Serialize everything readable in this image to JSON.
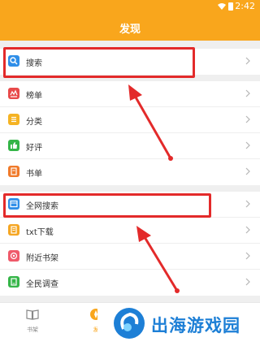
{
  "status_bar": {
    "time": "2:42"
  },
  "header": {
    "title": "发现"
  },
  "groups": [
    [
      {
        "label": "搜索",
        "icon": "search-icon",
        "color": "#2f8ee8"
      }
    ],
    [
      {
        "label": "榜单",
        "icon": "ranking-icon",
        "color": "#e84a4a"
      },
      {
        "label": "分类",
        "icon": "category-icon",
        "color": "#f5b323"
      },
      {
        "label": "好评",
        "icon": "thumbs-up-icon",
        "color": "#35b548"
      },
      {
        "label": "书单",
        "icon": "booklist-icon",
        "color": "#f07a2a"
      }
    ],
    [
      {
        "label": "全网搜索",
        "icon": "web-search-icon",
        "color": "#2f8ee8"
      },
      {
        "label": "txt下载",
        "icon": "txt-download-icon",
        "color": "#f5a623"
      },
      {
        "label": "附近书架",
        "icon": "nearby-shelf-icon",
        "color": "#ef5a6a"
      },
      {
        "label": "全民调查",
        "icon": "survey-icon",
        "color": "#35b548"
      }
    ]
  ],
  "bottom_nav": {
    "bookshelf": "书架",
    "discover": "发"
  },
  "watermark": {
    "text": "出海游戏园"
  },
  "colors": {
    "accent": "#f9a61c",
    "highlight": "#e32a2a"
  }
}
